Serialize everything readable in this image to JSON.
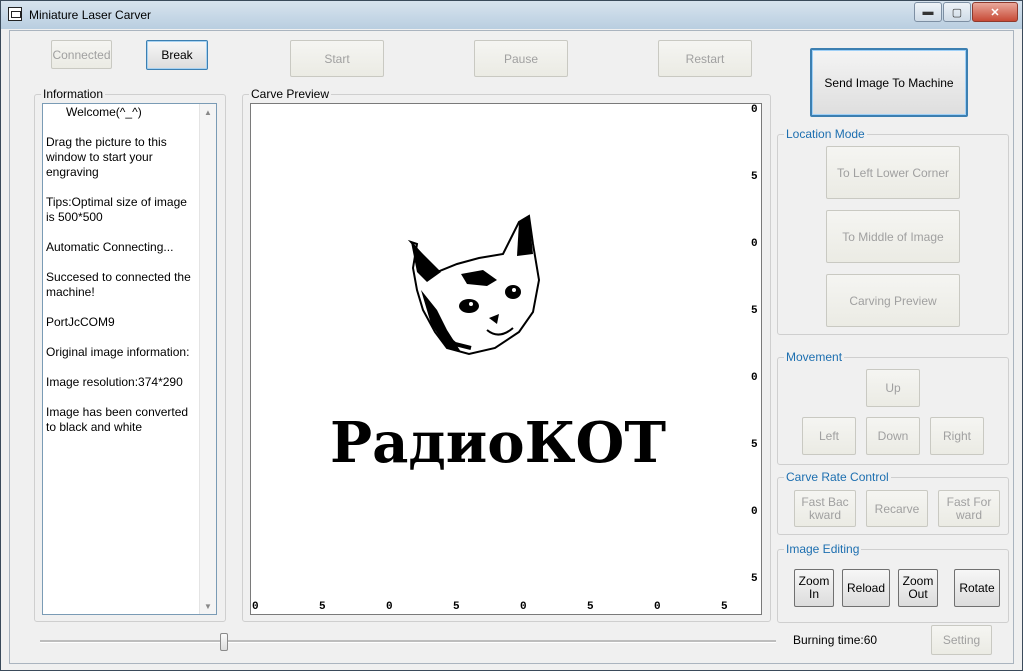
{
  "window": {
    "title": "Miniature Laser Carver",
    "controls": {
      "minimize": "▬",
      "maximize": "▢",
      "close": "✕"
    }
  },
  "toolbar": {
    "connected": "Connected",
    "break": "Break",
    "start": "Start",
    "pause": "Pause",
    "restart": "Restart"
  },
  "send_button": "Send Image To Machine",
  "information": {
    "label": "Information",
    "lines": [
      "      Welcome(^_^)",
      "",
      "Drag the picture to this window to start your engraving",
      "",
      "Tips:Optimal size of image is 500*500",
      "",
      "Automatic Connecting...",
      "",
      "Succesed to connected the machine!",
      "",
      "PortJcCOM9",
      "",
      "Original image information:",
      "",
      "Image resolution:374*290",
      "",
      "Image has been converted to black and white"
    ]
  },
  "preview": {
    "label": "Carve Preview",
    "image_text": "РадиоКОТ",
    "right_ticks": [
      "0",
      "5",
      "0",
      "5",
      "0",
      "5",
      "0",
      "5"
    ],
    "bottom_ticks": [
      "0",
      "5",
      "0",
      "5",
      "0",
      "5",
      "0",
      "5"
    ]
  },
  "location_mode": {
    "label": "Location Mode",
    "buttons": [
      "To Left Lower Corner",
      "To Middle of Image",
      "Carving Preview"
    ]
  },
  "movement": {
    "label": "Movement",
    "up": "Up",
    "left": "Left",
    "down": "Down",
    "right": "Right"
  },
  "carve_rate": {
    "label": "Carve Rate Control",
    "fast_backward": "Fast  Bac kward",
    "recarve": "Recarve",
    "fast_forward": "Fast   For ward"
  },
  "image_editing": {
    "label": "Image Editing",
    "zoom_in": "Zoom In",
    "reload": "Reload",
    "zoom_out": "Zoom Out",
    "rotate": "Rotate"
  },
  "burning_time": "Burning time:60",
  "setting": "Setting",
  "slider_value": 0.25
}
